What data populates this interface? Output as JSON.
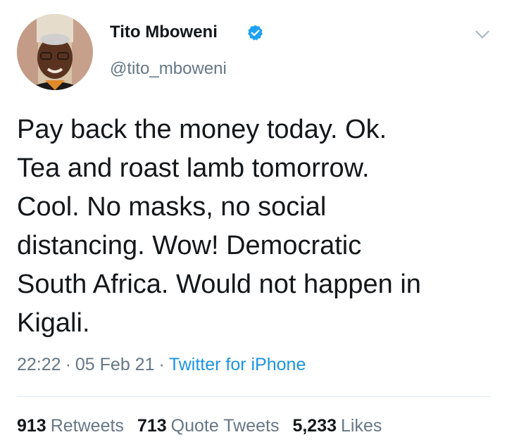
{
  "author": {
    "name": "Tito Mboweni",
    "handle": "@tito_mboweni",
    "verified": true,
    "avatar_icon": "profile-photo"
  },
  "tweet": {
    "lines": [
      "Pay back the money today. Ok.",
      "Tea and roast lamb tomorrow.",
      "Cool. No masks, no social",
      "distancing. Wow! Democratic",
      "South Africa. Would not happen in",
      "Kigali."
    ],
    "time": "22:22",
    "date": "05 Feb 21",
    "source": "Twitter for iPhone",
    "separator": "·"
  },
  "stats": {
    "retweets": {
      "count": "913",
      "label": "Retweets"
    },
    "quote_tweets": {
      "count": "713",
      "label": "Quote Tweets"
    },
    "likes": {
      "count": "5,233",
      "label": "Likes"
    }
  },
  "colors": {
    "text": "#14171a",
    "secondary": "#657786",
    "link": "#1b95e0",
    "verified": "#1da1f2",
    "divider": "#e1e8ed"
  }
}
